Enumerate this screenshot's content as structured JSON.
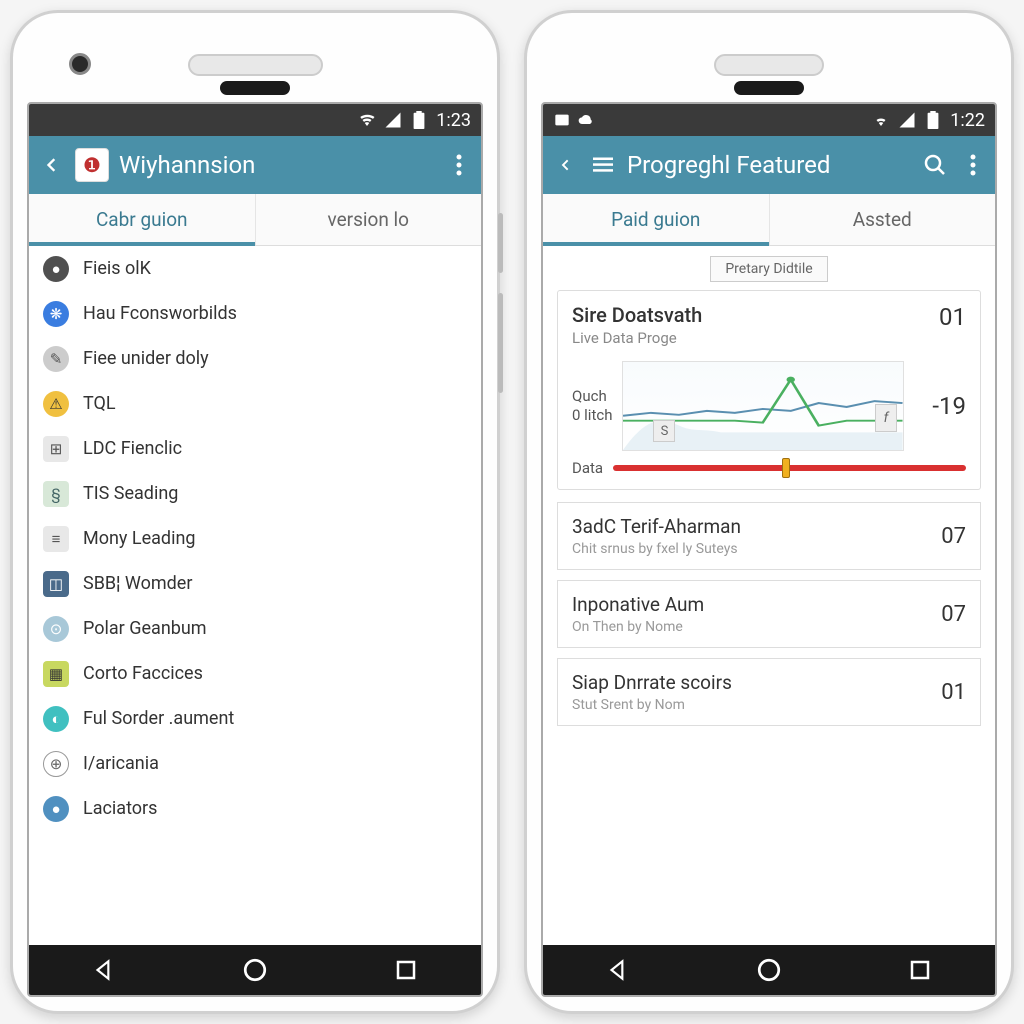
{
  "phoneA": {
    "statusbar": {
      "time": "1:23"
    },
    "appbar": {
      "title": "Wiyhannsion"
    },
    "tabs": [
      {
        "label": "Cabr guion",
        "active": true
      },
      {
        "label": "version lo",
        "active": false
      }
    ],
    "list": [
      {
        "label": "Fieis olK",
        "icon_bg": "#505050",
        "icon_glyph": "●"
      },
      {
        "label": "Hau Fconsworbilds",
        "icon_bg": "#3a7de0",
        "icon_glyph": "❋"
      },
      {
        "label": "Fiee unider doly",
        "icon_bg": "#cccccc",
        "icon_glyph": "✎"
      },
      {
        "label": "TQL",
        "icon_bg": "#f0c040",
        "icon_glyph": "⚠"
      },
      {
        "label": "LDC Fienclic",
        "icon_bg": "#e8e8e8",
        "icon_glyph": "⊞"
      },
      {
        "label": "TIS Seading",
        "icon_bg": "#d8e8d8",
        "icon_glyph": "§"
      },
      {
        "label": "Mony Leading",
        "icon_bg": "#e8e8e8",
        "icon_glyph": "≡"
      },
      {
        "label": "SBB¦ Womder",
        "icon_bg": "#4a6a8a",
        "icon_glyph": "◫"
      },
      {
        "label": "Polar Geanbum",
        "icon_bg": "#a8c8d8",
        "icon_glyph": "⊙"
      },
      {
        "label": "Corto Faccices",
        "icon_bg": "#c8d860",
        "icon_glyph": "▦"
      },
      {
        "label": "Ful Sorder .aument",
        "icon_bg": "#40c0c0",
        "icon_glyph": "◐"
      },
      {
        "label": "I/aricania",
        "icon_bg": "#ffffff",
        "icon_glyph": "⊕"
      },
      {
        "label": "Laciators",
        "icon_bg": "#5090c0",
        "icon_glyph": "●"
      }
    ]
  },
  "phoneB": {
    "statusbar": {
      "time": "1:22"
    },
    "appbar": {
      "title": "Progreghl Featured"
    },
    "tabs": [
      {
        "label": "Paid guion",
        "active": true
      },
      {
        "label": "Assted",
        "active": false
      }
    ],
    "card_tab_label": "Pretary Didtile",
    "dataCard": {
      "title": "Sire Doatsvath",
      "subtitle": "Live Data Proge",
      "value": "01",
      "chart_left1": "Quch",
      "chart_left2": "0 litch",
      "chart_badge_left": "S",
      "chart_badge_right": "f",
      "chart_yval": "-19",
      "slider_label": "Data"
    },
    "rows": [
      {
        "title": "3adC Terif-Aharman",
        "sub": "Chit srnus by fxel ly Suteys",
        "num": "07"
      },
      {
        "title": "Inponative Aum",
        "sub": "On Then by Nome",
        "num": "07"
      },
      {
        "title": "Siap Dnrrate scoirs",
        "sub": "Stut Srent by Nom",
        "num": "01"
      }
    ]
  },
  "chart_data": {
    "type": "line",
    "series": [
      {
        "name": "blue",
        "values": [
          35,
          38,
          36,
          40,
          38,
          42,
          40,
          48,
          44,
          50
        ],
        "color": "#5a8fb0"
      },
      {
        "name": "green",
        "values": [
          30,
          30,
          30,
          30,
          30,
          28,
          78,
          25,
          30,
          30
        ],
        "color": "#4ab060"
      }
    ],
    "ylim": [
      0,
      100
    ]
  }
}
